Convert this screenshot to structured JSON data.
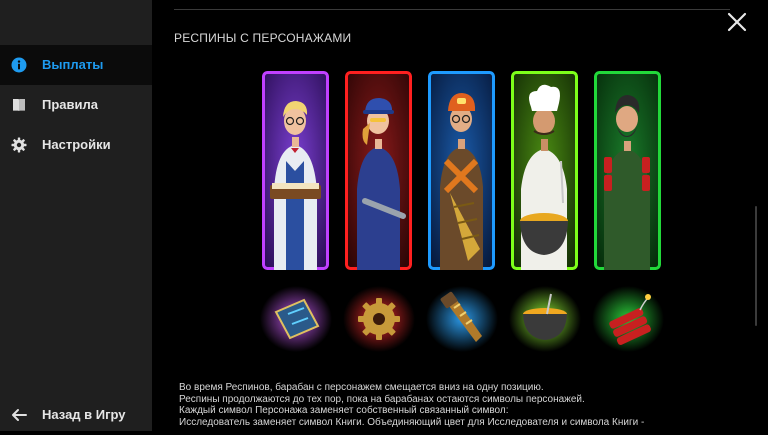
{
  "sidebar": {
    "items": [
      {
        "label": "Выплаты",
        "icon": "info-icon",
        "active": true
      },
      {
        "label": "Правила",
        "icon": "book-icon",
        "active": false
      },
      {
        "label": "Настройки",
        "icon": "gear-icon",
        "active": false
      }
    ],
    "back_label": "Назад в Игру",
    "back_icon": "arrow-left-icon"
  },
  "main": {
    "section_title": "РЕСПИНЫ С ПЕРСОНАЖАМИ",
    "close_icon": "close-icon",
    "characters": [
      {
        "name": "explorer",
        "frame_color": "#b030ff",
        "symbol": "book"
      },
      {
        "name": "mechanic",
        "frame_color": "#ff2020",
        "symbol": "gear"
      },
      {
        "name": "miner",
        "frame_color": "#1e9bff",
        "symbol": "drill"
      },
      {
        "name": "cook",
        "frame_color": "#7dff1a",
        "symbol": "cauldron"
      },
      {
        "name": "demolitionist",
        "frame_color": "#22d83a",
        "symbol": "dynamite"
      }
    ],
    "description": [
      "Во время Респинов, барабан с персонажем смещается вниз на одну позицию.",
      "Респины продолжаются до тех пор, пока на барабанах остаются символы персонажей.",
      "Каждый символ Персонажа заменяет собственный связанный символ:",
      "Исследователь заменяет символ Книги. Объединяющий цвет для Исследователя и символа Книги -"
    ]
  },
  "colors": {
    "accent": "#1e9bf0",
    "sidebar_bg": "#1f1f1f",
    "active_item_bg": "#0b0b0b"
  }
}
